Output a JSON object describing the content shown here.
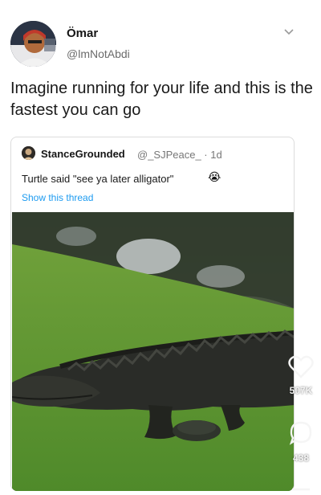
{
  "author": {
    "name": "Ömar",
    "handle": "@lmNotAbdi"
  },
  "tweet": {
    "text": "Imagine running for your life and this is the fastest you can go"
  },
  "quoted": {
    "name": "StanceGrounded",
    "meta": "@_SJPeace_ · 1d",
    "text": "Turtle said \"see ya later alligator\"",
    "emoji": "😭",
    "show_thread": "Show this thread"
  },
  "actions": {
    "likes": "507K",
    "comments": "438"
  },
  "icons": {
    "avatar": "profile-photo",
    "menu": "chevron-down-icon",
    "like": "heart-icon",
    "comment": "comment-icon",
    "share": "share-icon"
  },
  "colors": {
    "link": "#1d9bf0",
    "text": "#111111",
    "muted": "#6b6b6b"
  }
}
